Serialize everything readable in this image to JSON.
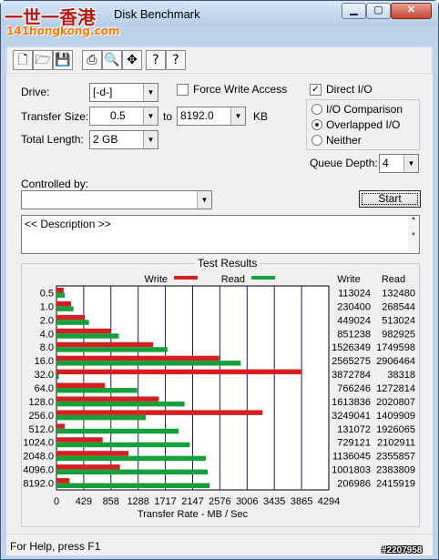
{
  "window": {
    "title": "Disk Benchmark",
    "watermark_line1": "一世一香港",
    "watermark_line2": "141hongkong.com",
    "corner_tag": "#2207958",
    "min": "0",
    "max": "1",
    "close": "r"
  },
  "toolbar": {
    "icons": [
      "new-icon",
      "open-icon",
      "save-icon",
      "print-icon",
      "print-preview-icon",
      "move-icon",
      "help-icon",
      "context-help-icon"
    ],
    "glyphs": [
      "🗋",
      "🗁",
      "💾",
      "⎙",
      "🔍",
      "✥",
      "?",
      "?"
    ]
  },
  "form": {
    "drive_label": "Drive:",
    "drive_value": "[-d-]",
    "force_write_label": "Force Write Access",
    "force_write_checked": false,
    "direct_io_label": "Direct I/O",
    "direct_io_checked": true,
    "transfer_size_label": "Transfer Size:",
    "transfer_from": "0.5",
    "to_label": "to",
    "transfer_to": "8192.0",
    "kb_label": "KB",
    "total_length_label": "Total Length:",
    "total_length_value": "2 GB",
    "io_options": [
      "I/O Comparison",
      "Overlapped I/O",
      "Neither"
    ],
    "io_selected": 1,
    "queue_depth_label": "Queue Depth:",
    "queue_depth_value": "4",
    "controlled_by_label": "Controlled by:",
    "controlled_by_value": "",
    "start_label": "Start",
    "description": "<< Description >>"
  },
  "results": {
    "title": "Test Results",
    "write_col": "Write",
    "read_col": "Read"
  },
  "chart_data": {
    "type": "bar",
    "orientation": "horizontal",
    "xlabel": "Transfer Rate - MB / Sec",
    "ticks": [
      0,
      429,
      858,
      1288,
      1717,
      2147,
      2576,
      3006,
      3435,
      3865,
      4294
    ],
    "xlim": [
      0,
      4294
    ],
    "categories": [
      "0.5",
      "1.0",
      "2.0",
      "4.0",
      "8.0",
      "16.0",
      "32.0",
      "64.0",
      "128.0",
      "256.0",
      "512.0",
      "1024.0",
      "2048.0",
      "4096.0",
      "8192.0"
    ],
    "series": [
      {
        "name": "Write",
        "color": "#d42020",
        "values": [
          113024,
          230400,
          449024,
          851238,
          1526349,
          2565275,
          3872784,
          766246,
          1613836,
          3249041,
          131072,
          729121,
          1136045,
          1001803,
          206986
        ]
      },
      {
        "name": "Read",
        "color": "#16a03a",
        "values": [
          132480,
          268544,
          513024,
          982925,
          1749598,
          2906464,
          38318,
          1272814,
          2020807,
          1409909,
          1926065,
          2102911,
          2355857,
          2383809,
          2415919
        ]
      }
    ],
    "value_unit_note_scale": 1000,
    "grid": true,
    "legend": "top"
  },
  "status": {
    "text": "For Help, press F1"
  }
}
